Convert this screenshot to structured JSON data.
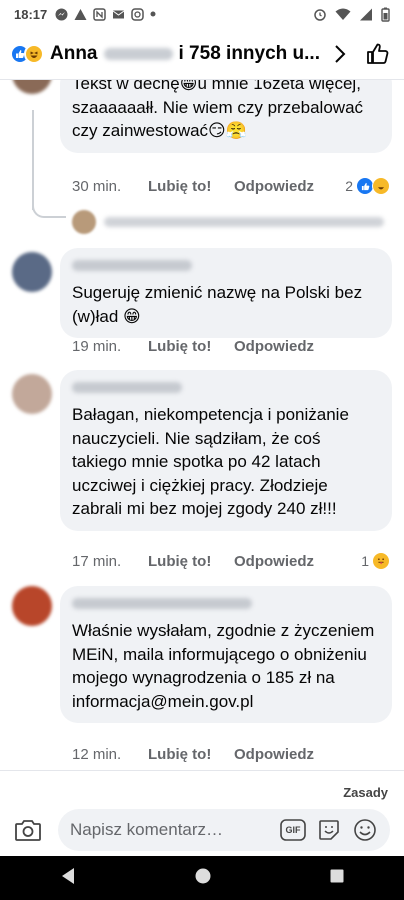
{
  "status_bar": {
    "time": "18:17"
  },
  "header": {
    "name_start": "Anna",
    "name_rest": "i 758 innych u..."
  },
  "comments": [
    {
      "text": "Tekst w dechę😁u mnie 16zeta więcej, szaaaaaałł. Nie wiem czy przebalować czy zainwestować😏😤",
      "age": "30 min.",
      "like_label": "Lubię to!",
      "reply_label": "Odpowiedz",
      "reaction_count": "2"
    },
    {
      "text": "Sugeruję zmienić nazwę na Polski bez (w)ład 😁",
      "age": "19 min.",
      "like_label": "Lubię to!",
      "reply_label": "Odpowiedz"
    },
    {
      "text": "Bałagan, niekompetencja i poniżanie nauczycieli. Nie sądziłam, że coś takiego mnie spotka po 42 latach uczciwej i ciężkiej pracy. Złodzieje zabrali mi bez mojej zgody 240 zł!!!",
      "age": "17 min.",
      "like_label": "Lubię to!",
      "reply_label": "Odpowiedz",
      "reaction_count": "1"
    },
    {
      "text": "Właśnie wysłałam, zgodnie z życzeniem MEiN, maila informującego o obniżeniu mojego wynagrodzenia o 185 zł na informacja@mein.gov.pl",
      "age": "12 min.",
      "like_label": "Lubię to!",
      "reply_label": "Odpowiedz"
    }
  ],
  "footer": {
    "policy_link": "Zasady",
    "input_placeholder": "Napisz komentarz…",
    "gif_label": "GIF"
  },
  "colors": {
    "facebook_blue": "#1877f2",
    "bubble_bg": "#f0f2f5",
    "muted_text": "#65676b"
  }
}
